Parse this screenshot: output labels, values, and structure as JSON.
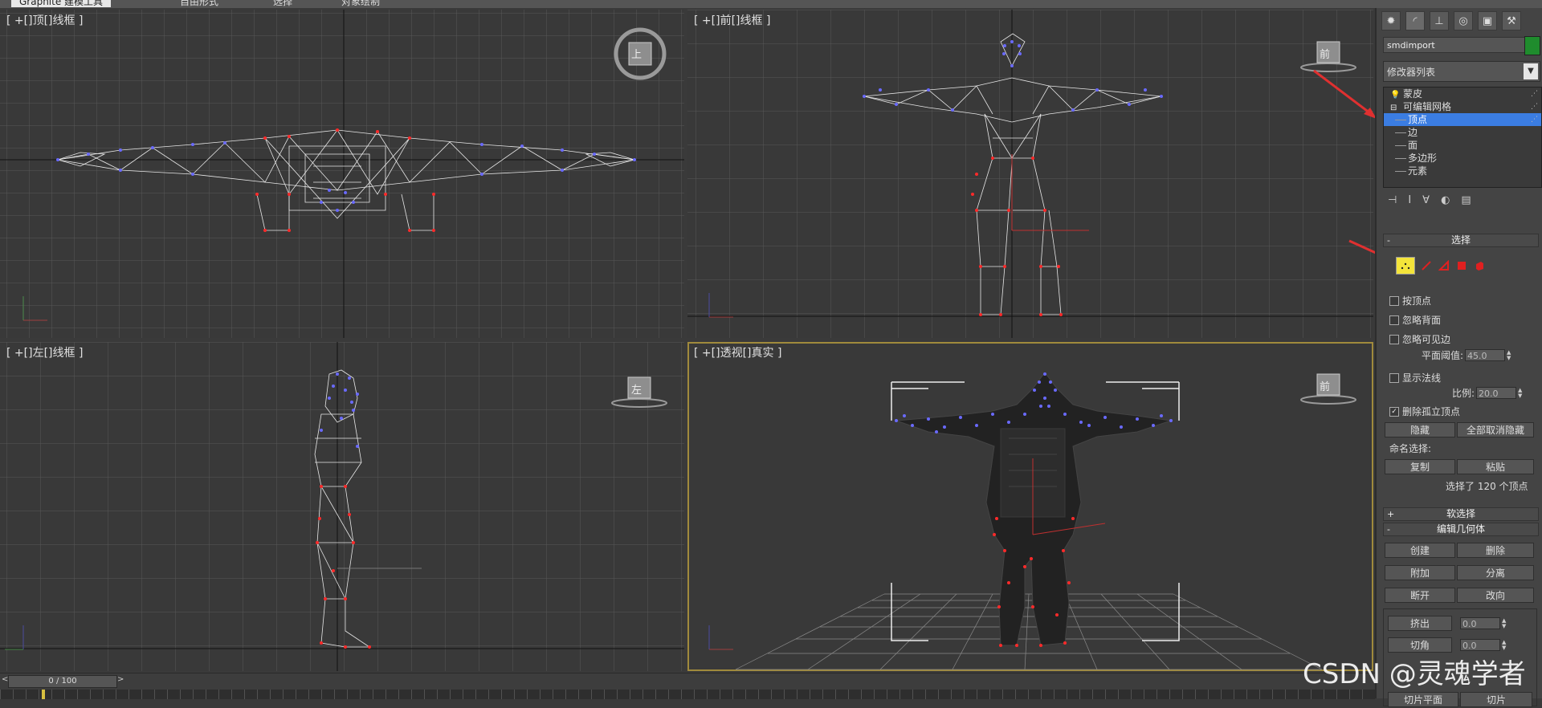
{
  "ribbon": {
    "tabs": [
      "Graphite 建模工具",
      "自由形式",
      "选择",
      "对象绘制"
    ]
  },
  "viewports": {
    "top": {
      "label": "[ +[]顶[]线框 ]",
      "cube_label": "上"
    },
    "front": {
      "label": "[ +[]前[]线框 ]",
      "cube_label": "前"
    },
    "left": {
      "label": "[ +[]左[]线框 ]",
      "cube_label": "左"
    },
    "perspective": {
      "label": "[ +[]透视[]真实 ]",
      "cube_label": "前"
    }
  },
  "command_panel": {
    "tab_icons": [
      "create-icon",
      "modify-icon",
      "hierarchy-icon",
      "motion-icon",
      "display-icon",
      "utilities-icon"
    ],
    "object_name": "smdimport",
    "object_color": "#1f8c2d",
    "modifier_list_label": "修改器列表",
    "stack": [
      {
        "label": "蒙皮",
        "icon": "bulb-icon",
        "level": 0
      },
      {
        "label": "可编辑网格",
        "icon": "minus-icon",
        "level": 0
      },
      {
        "label": "顶点",
        "level": 1,
        "selected": true
      },
      {
        "label": "边",
        "level": 1
      },
      {
        "label": "面",
        "level": 1
      },
      {
        "label": "多边形",
        "level": 1
      },
      {
        "label": "元素",
        "level": 1
      }
    ],
    "selection": {
      "title": "选择",
      "by_vertex": "按顶点",
      "ignore_backfacing": "忽略背面",
      "ignore_visible_edges": "忽略可见边",
      "planar_threshold_label": "平面阈值:",
      "planar_threshold_value": "45.0",
      "show_normals": "显示法线",
      "scale_label": "比例:",
      "scale_value": "20.0",
      "delete_isolated": "删除孤立顶点",
      "delete_isolated_checked": true,
      "hide_btn": "隐藏",
      "unhide_all_btn": "全部取消隐藏",
      "named_selections": "命名选择:",
      "copy_btn": "复制",
      "paste_btn": "粘贴",
      "status": "选择了 120 个顶点"
    },
    "soft_selection": {
      "title": "软选择"
    },
    "edit_geometry": {
      "title": "编辑几何体",
      "create_btn": "创建",
      "delete_btn": "删除",
      "attach_btn": "附加",
      "detach_btn": "分离",
      "break_btn": "断开",
      "turn_btn": "改向",
      "extrude_btn": "挤出",
      "extrude_value": "0.0",
      "chamfer_btn": "切角",
      "chamfer_value": "0.0",
      "slice_plane_btn": "切片平面",
      "slice_btn": "切片"
    }
  },
  "timeline": {
    "frame_display": "0 / 100"
  },
  "watermark": "CSDN @灵魂学者"
}
